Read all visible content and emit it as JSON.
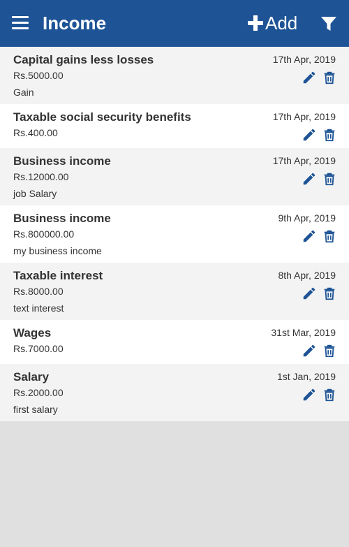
{
  "header": {
    "title": "Income",
    "add_label": "Add",
    "menu_icon": "menu-icon",
    "filter_icon": "filter-icon",
    "bg_color": "#1e5496"
  },
  "items": [
    {
      "name": "Capital gains less losses",
      "amount": "Rs.5000.00",
      "note": "Gain",
      "date": "17th Apr, 2019"
    },
    {
      "name": "Taxable social security benefits",
      "amount": "Rs.400.00",
      "note": "",
      "date": "17th Apr, 2019"
    },
    {
      "name": "Business income",
      "amount": "Rs.12000.00",
      "note": "job Salary",
      "date": "17th Apr, 2019"
    },
    {
      "name": "Business income",
      "amount": "Rs.800000.00",
      "note": "my business income",
      "date": "9th Apr, 2019"
    },
    {
      "name": "Taxable interest",
      "amount": "Rs.8000.00",
      "note": "text interest",
      "date": "8th Apr, 2019"
    },
    {
      "name": "Wages",
      "amount": "Rs.7000.00",
      "note": "",
      "date": "31st Mar, 2019"
    },
    {
      "name": "Salary",
      "amount": "Rs.2000.00",
      "note": "first salary",
      "date": "1st Jan, 2019"
    }
  ]
}
